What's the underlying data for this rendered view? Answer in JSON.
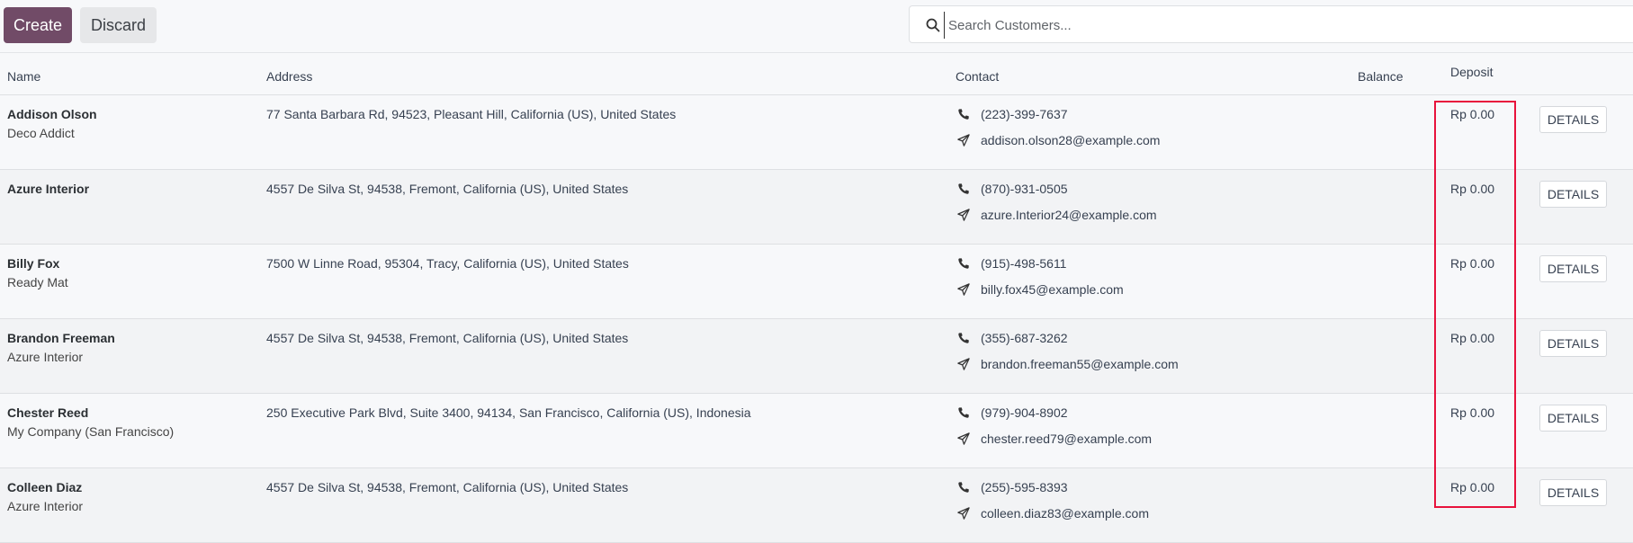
{
  "toolbar": {
    "create_label": "Create",
    "discard_label": "Discard"
  },
  "search": {
    "placeholder": "Search Customers..."
  },
  "columns": {
    "name": "Name",
    "address": "Address",
    "contact": "Contact",
    "balance": "Balance",
    "deposit": "Deposit"
  },
  "customers": [
    {
      "name": "Addison Olson",
      "company": "Deco Addict",
      "address": "77 Santa Barbara Rd, 94523, Pleasant Hill, California (US), United States",
      "phone": "(223)-399-7637",
      "email": "addison.olson28@example.com",
      "balance": "",
      "deposit": "Rp 0.00",
      "action": "DETAILS"
    },
    {
      "name": "Azure Interior",
      "company": "",
      "address": "4557 De Silva St, 94538, Fremont, California (US), United States",
      "phone": "(870)-931-0505",
      "email": "azure.Interior24@example.com",
      "balance": "",
      "deposit": "Rp 0.00",
      "action": "DETAILS"
    },
    {
      "name": "Billy Fox",
      "company": "Ready Mat",
      "address": "7500 W Linne Road, 95304, Tracy, California (US), United States",
      "phone": "(915)-498-5611",
      "email": "billy.fox45@example.com",
      "balance": "",
      "deposit": "Rp 0.00",
      "action": "DETAILS"
    },
    {
      "name": "Brandon Freeman",
      "company": "Azure Interior",
      "address": "4557 De Silva St, 94538, Fremont, California (US), United States",
      "phone": "(355)-687-3262",
      "email": "brandon.freeman55@example.com",
      "balance": "",
      "deposit": "Rp 0.00",
      "action": "DETAILS"
    },
    {
      "name": "Chester Reed",
      "company": "My Company (San Francisco)",
      "address": "250 Executive Park Blvd, Suite 3400, 94134, San Francisco, California (US), Indonesia",
      "phone": "(979)-904-8902",
      "email": "chester.reed79@example.com",
      "balance": "",
      "deposit": "Rp 0.00",
      "action": "DETAILS"
    },
    {
      "name": "Colleen Diaz",
      "company": "Azure Interior",
      "address": "4557 De Silva St, 94538, Fremont, California (US), United States",
      "phone": "(255)-595-8393",
      "email": "colleen.diaz83@example.com",
      "balance": "",
      "deposit": "Rp 0.00",
      "action": "DETAILS"
    }
  ],
  "colors": {
    "primary": "#714b67",
    "highlight": "#e8123c"
  },
  "icons": {
    "search": "search-icon",
    "phone": "phone-icon",
    "email": "paper-plane-icon"
  }
}
